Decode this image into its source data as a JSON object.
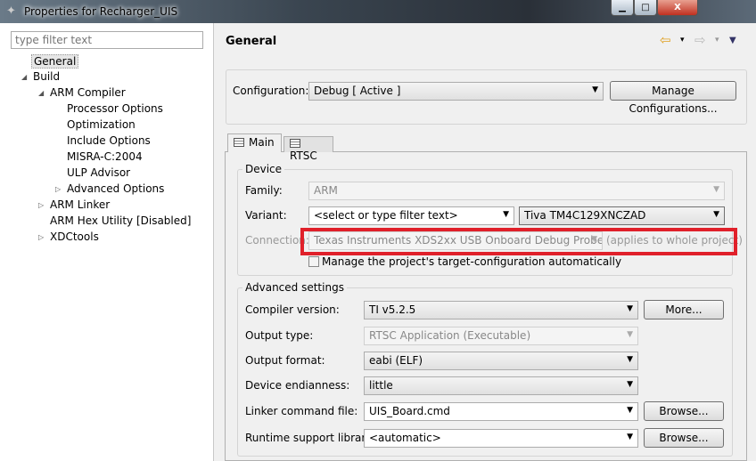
{
  "window": {
    "title": "Properties for Recharger_UIS",
    "minimize": "▁",
    "maximize": "□",
    "close": "X"
  },
  "sidebar": {
    "filter_placeholder": "type filter text",
    "items": [
      {
        "label": "General"
      },
      {
        "label": "Build"
      },
      {
        "label": "ARM Compiler"
      },
      {
        "label": "Processor Options"
      },
      {
        "label": "Optimization"
      },
      {
        "label": "Include Options"
      },
      {
        "label": "MISRA-C:2004"
      },
      {
        "label": "ULP Advisor"
      },
      {
        "label": "Advanced Options"
      },
      {
        "label": "ARM Linker"
      },
      {
        "label": "ARM Hex Utility  [Disabled]"
      },
      {
        "label": "XDCtools"
      }
    ]
  },
  "header": {
    "title": "General",
    "back": "⇦",
    "forward": "⇨",
    "menu": "▼",
    "dropdown": "▾"
  },
  "config": {
    "label": "Configuration:",
    "value": "Debug  [ Active ]",
    "manage_button": "Manage Configurations..."
  },
  "tabs": [
    {
      "label": "Main"
    },
    {
      "label": "RTSC"
    }
  ],
  "device": {
    "group": "Device",
    "family_label": "Family:",
    "family_value": "ARM",
    "variant_label": "Variant:",
    "variant_filter": "<select or type filter text>",
    "variant_value": "Tiva TM4C129XNCZAD",
    "connection_label": "Connection:",
    "connection_value": "Texas Instruments XDS2xx USB Onboard Debug Probe",
    "connection_note": "(applies to whole project)",
    "manage_checkbox": "Manage the project's target-configuration automatically",
    "highlight_color": "#e0202a"
  },
  "advanced": {
    "group": "Advanced settings",
    "rows": [
      {
        "label": "Compiler version:",
        "value": "TI v5.2.5",
        "button": "More..."
      },
      {
        "label": "Output type:",
        "value": "RTSC Application (Executable)"
      },
      {
        "label": "Output format:",
        "value": "eabi (ELF)"
      },
      {
        "label": "Device endianness:",
        "value": "little"
      },
      {
        "label": "Linker command file:",
        "value": "UIS_Board.cmd",
        "button": "Browse..."
      },
      {
        "label": "Runtime support library:",
        "value": "<automatic>",
        "button": "Browse..."
      }
    ]
  }
}
